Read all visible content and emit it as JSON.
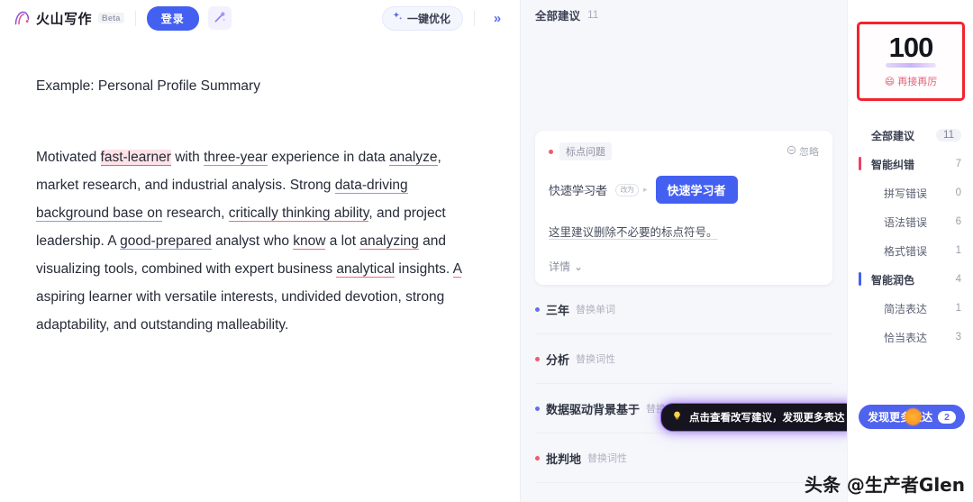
{
  "header": {
    "brand_name": "火山写作",
    "beta_label": "Beta",
    "login_label": "登录",
    "magic_icon": "magic-wand-icon",
    "optimize_label": "一键优化",
    "optimize_icon": "sparkle-icon",
    "collapse_icon": "chevron-double-right-icon"
  },
  "document": {
    "title": "Example: Personal Profile Summary",
    "paragraph": {
      "s1": "Motivated ",
      "err1": "fast-learner",
      "s2": " with ",
      "err2": "three-year",
      "s3": " experience in data ",
      "err3": "analyze",
      "s4": ", market research, and industrial analysis. Strong ",
      "err4": "data-driving background base on",
      "s5": " research, ",
      "err5": "critically thinking ability",
      "s6": ", and project leadership. A ",
      "err6": "good-prepared",
      "s7": " analyst who ",
      "err7": "know",
      "s8": " a lot ",
      "err8": "analyzing",
      "s9": " and visualizing tools, combined with expert business ",
      "err9": "analytical",
      "s10": " insights. ",
      "err10": "A",
      "s11": " aspiring learner with versatile interests, undivided devotion, strong adaptability, and outstanding malleability."
    }
  },
  "suggestions": {
    "header_title": "全部建议",
    "header_count": "11",
    "card": {
      "tag": "标点问题",
      "ignore_label": "忽略",
      "ignore_icon": "circle-minus-icon",
      "original": "快速学习者",
      "arrow_pill": "改为",
      "replacement": "快速学习者",
      "description": "这里建议删除不必要的标点符号。",
      "more_label": "详情",
      "more_icon": "chevron-down-icon"
    },
    "rows": [
      {
        "word": "三年",
        "kind": "替换单词",
        "dot": "blue"
      },
      {
        "word": "分析",
        "kind": "替换词性",
        "dot": "red"
      },
      {
        "word": "数据驱动背景基于",
        "kind": "替换",
        "dot": "blue"
      },
      {
        "word": "批判地",
        "kind": "替换词性",
        "dot": "red"
      }
    ],
    "tooltip": {
      "icon": "lightbulb-icon",
      "text": "点击查看改写建议，发现更多表达"
    }
  },
  "sidebar": {
    "score": {
      "value": "100",
      "emoji": "😄",
      "label": "再接再厉"
    },
    "nav": [
      {
        "label": "全部建议",
        "count": "11",
        "bar": "none",
        "level": "top",
        "pill": true
      },
      {
        "label": "智能纠错",
        "count": "7",
        "bar": "red",
        "level": "top",
        "pill": false
      },
      {
        "label": "拼写错误",
        "count": "0",
        "bar": "none",
        "level": "sub",
        "pill": false
      },
      {
        "label": "语法错误",
        "count": "6",
        "bar": "none",
        "level": "sub",
        "pill": false
      },
      {
        "label": "格式错误",
        "count": "1",
        "bar": "none",
        "level": "sub",
        "pill": false
      },
      {
        "label": "智能润色",
        "count": "4",
        "bar": "blue",
        "level": "top",
        "pill": false
      },
      {
        "label": "简洁表达",
        "count": "1",
        "bar": "none",
        "level": "sub",
        "pill": false
      },
      {
        "label": "恰当表达",
        "count": "3",
        "bar": "none",
        "level": "sub",
        "pill": false
      }
    ],
    "discover": {
      "label": "发现更多表达",
      "count": "2"
    }
  },
  "watermark": "头条 @生产者Glen",
  "colors": {
    "accent_blue": "#4460f1",
    "error_red": "#ef5a6f",
    "score_border": "#f5222d",
    "tooltip_glow": "#8f5cf6"
  }
}
